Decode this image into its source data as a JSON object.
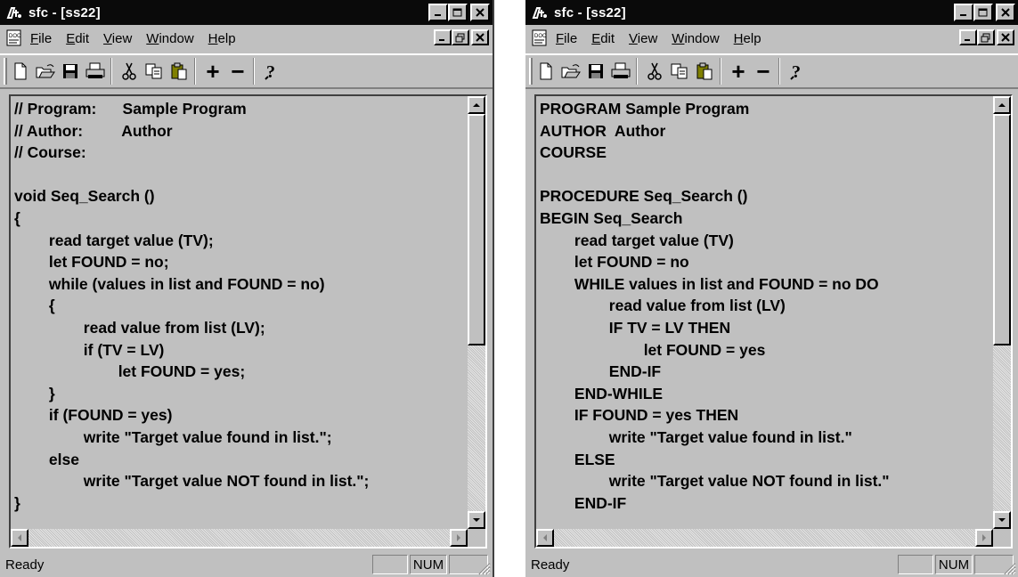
{
  "windows": [
    {
      "title": "sfc - [ss22]",
      "menu": [
        "File",
        "Edit",
        "View",
        "Window",
        "Help"
      ],
      "menu_underline": [
        "F",
        "E",
        "V",
        "W",
        "H"
      ],
      "code_lines": [
        "// Program:      Sample Program",
        "// Author:         Author",
        "// Course:",
        "",
        "void Seq_Search ()",
        "{",
        "        read target value (TV);",
        "        let FOUND = no;",
        "        while (values in list and FOUND = no)",
        "        {",
        "                read value from list (LV);",
        "                if (TV = LV)",
        "                        let FOUND = yes;",
        "        }",
        "        if (FOUND = yes)",
        "                write \"Target value found in list.\";",
        "        else",
        "                write \"Target value NOT found in list.\";",
        "}"
      ],
      "status": "Ready",
      "num_indicator": "NUM",
      "vscroll_thumb_fraction": 0.0
    },
    {
      "title": "sfc - [ss22]",
      "menu": [
        "File",
        "Edit",
        "View",
        "Window",
        "Help"
      ],
      "menu_underline": [
        "F",
        "E",
        "V",
        "W",
        "H"
      ],
      "code_lines": [
        "PROGRAM Sample Program",
        "AUTHOR  Author",
        "COURSE",
        "",
        "PROCEDURE Seq_Search ()",
        "BEGIN Seq_Search",
        "        read target value (TV)",
        "        let FOUND = no",
        "        WHILE values in list and FOUND = no DO",
        "                read value from list (LV)",
        "                IF TV = LV THEN",
        "                        let FOUND = yes",
        "                END-IF",
        "        END-WHILE",
        "        IF FOUND = yes THEN",
        "                write \"Target value found in list.\"",
        "        ELSE",
        "                write \"Target value NOT found in list.\"",
        "        END-IF"
      ],
      "status": "Ready",
      "num_indicator": "NUM",
      "vscroll_thumb_fraction": 0.0
    }
  ],
  "toolbar_icons": [
    "new-file-icon",
    "open-folder-icon",
    "save-disk-icon",
    "print-icon",
    "cut-scissors-icon",
    "copy-icon",
    "paste-icon",
    "plus-icon",
    "minus-icon",
    "help-icon"
  ],
  "toolbar_glyphs": {
    "plus": "+",
    "minus": "−",
    "help": "?"
  },
  "colors": {
    "titlebar": "#0a0a0a",
    "face": "#c0c0c0",
    "text": "#000000"
  }
}
